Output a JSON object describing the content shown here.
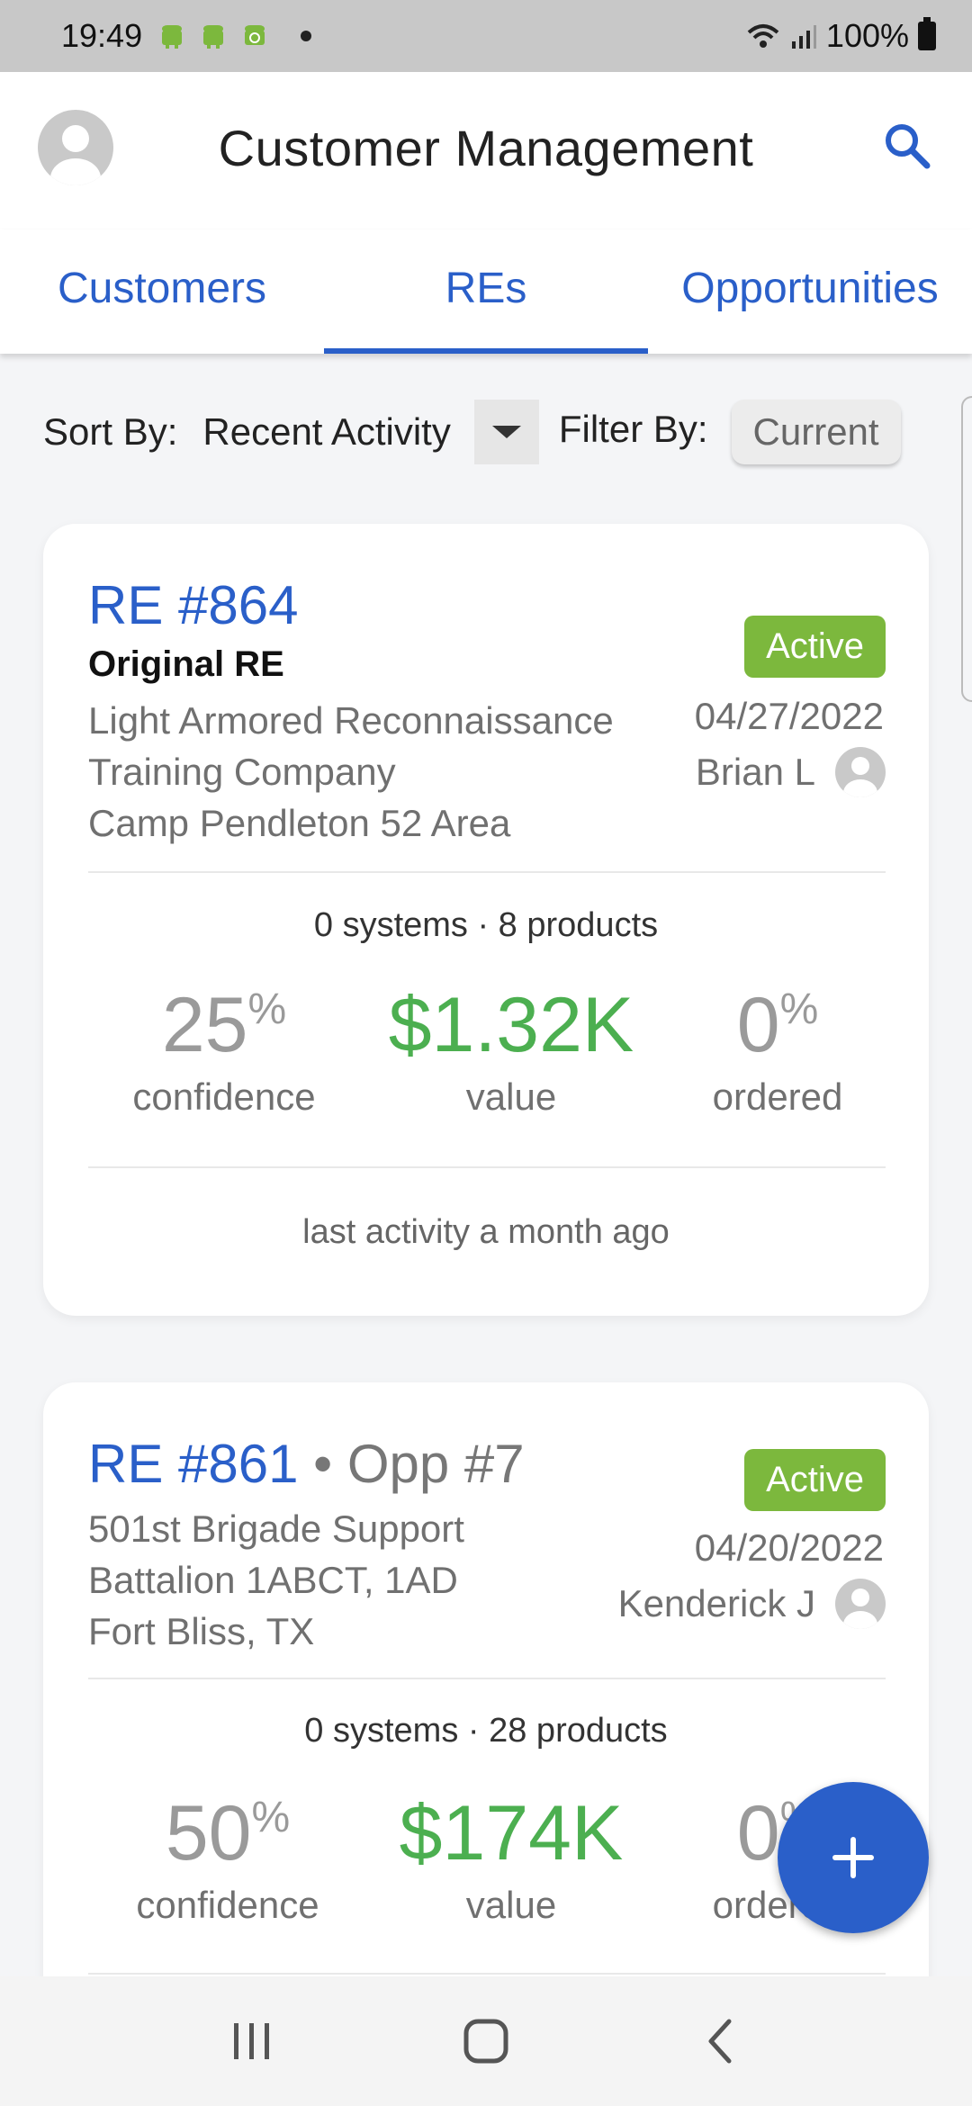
{
  "status_bar": {
    "time": "19:49",
    "battery": "100%"
  },
  "header": {
    "title": "Customer Management"
  },
  "tabs": [
    {
      "label": "Customers"
    },
    {
      "label": "REs"
    },
    {
      "label": "Opportunities"
    }
  ],
  "controls": {
    "sort_label": "Sort By:",
    "sort_value": "Recent Activity",
    "filter_label": "Filter By:",
    "filter_value": "Current"
  },
  "cards": [
    {
      "re": "RE #864",
      "subtitle": "Original RE",
      "address": [
        "Light Armored Reconnaissance",
        "Training Company",
        "Camp Pendleton 52 Area"
      ],
      "status": "Active",
      "date": "04/27/2022",
      "owner": "Brian L",
      "summary": "0 systems · 8 products",
      "confidence": "25",
      "confidence_label": "confidence",
      "value": "$1.32K",
      "value_label": "value",
      "ordered": "0",
      "ordered_label": "ordered",
      "last_activity": "last activity a month ago"
    },
    {
      "re": "RE #861",
      "opp": "• Opp #7",
      "address": [
        "501st Brigade Support",
        "Battalion 1ABCT, 1AD",
        "Fort Bliss, TX"
      ],
      "status": "Active",
      "date": "04/20/2022",
      "owner": "Kenderick J",
      "summary": "0 systems · 28 products",
      "confidence": "50",
      "confidence_label": "confidence",
      "value": "$174K",
      "value_label": "value",
      "ordered": "0",
      "ordered_label": "ordered"
    }
  ],
  "units": {
    "percent": "%"
  },
  "icons": {
    "status": [
      "android-icon",
      "android-icon",
      "android-debug-icon",
      "dot-icon",
      "wifi-icon",
      "signal-icon",
      "battery-icon"
    ],
    "header": [
      "avatar",
      "search-icon"
    ],
    "nav": [
      "recents-icon",
      "home-icon",
      "back-icon"
    ],
    "fab": "plus-icon"
  },
  "colors": {
    "accent": "#2a5fc9",
    "active_badge": "#7cb83d",
    "value_green": "#4caf50"
  }
}
